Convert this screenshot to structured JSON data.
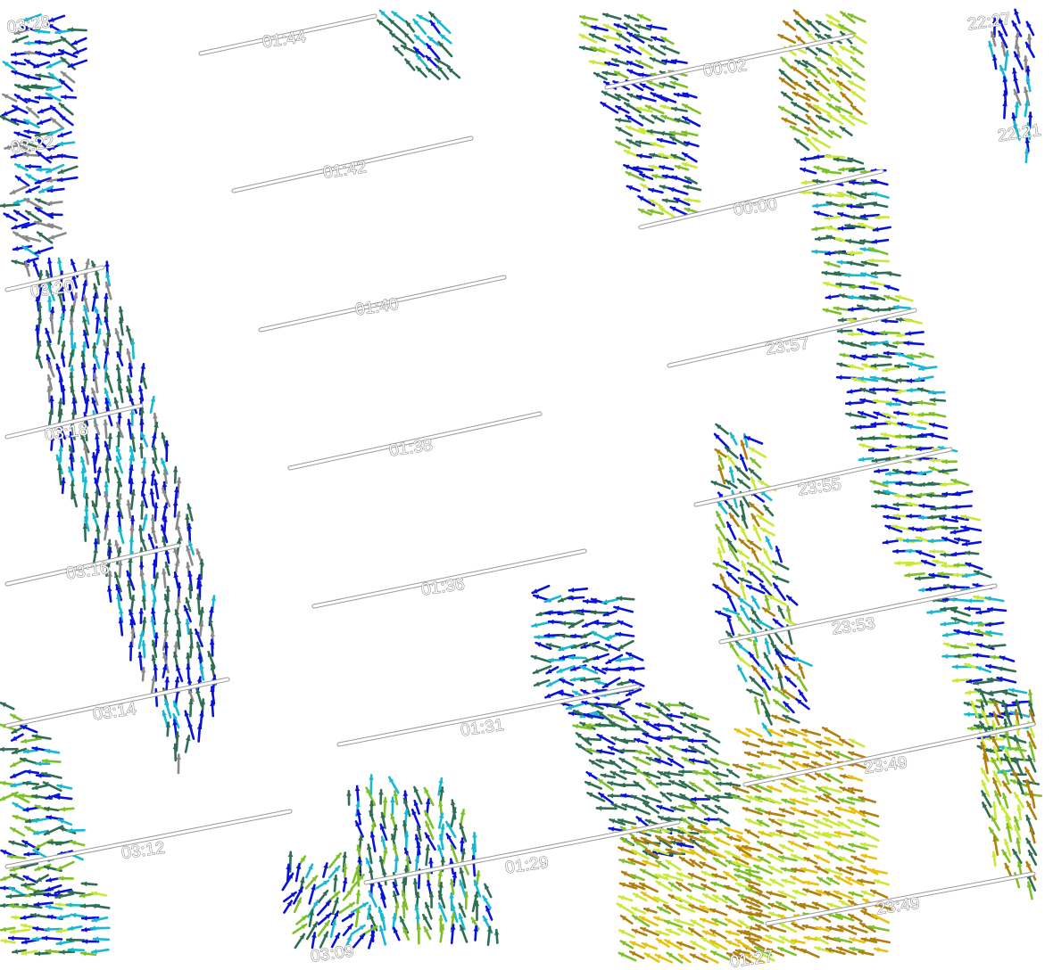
{
  "colors": {
    "background": "#ffffff",
    "track_outline": "#9a9a9a",
    "label_outline": "#6e6e6e",
    "wind_palette": [
      "#0a12d8",
      "#1ab8d0",
      "#2e6e52",
      "#7fbf2a",
      "#c9e83a",
      "#b07f10",
      "#e8c010",
      "#8a8a8a",
      "#2b2b2b"
    ]
  },
  "swaths": [
    {
      "id": "swath-left",
      "times": [
        "03:28",
        "03:22",
        "03:20",
        "03:18",
        "03:16",
        "03:14",
        "03:12",
        "03:09"
      ]
    },
    {
      "id": "swath-middle",
      "times": [
        "01:44",
        "01:42",
        "01:40",
        "01:38",
        "01:36",
        "01:31",
        "01:29",
        "01:27"
      ]
    },
    {
      "id": "swath-right",
      "times": [
        "00:02",
        "00:00",
        "23:57",
        "23:55",
        "23:53",
        "23:49",
        "23:49",
        "22:27",
        "22:21"
      ]
    }
  ]
}
